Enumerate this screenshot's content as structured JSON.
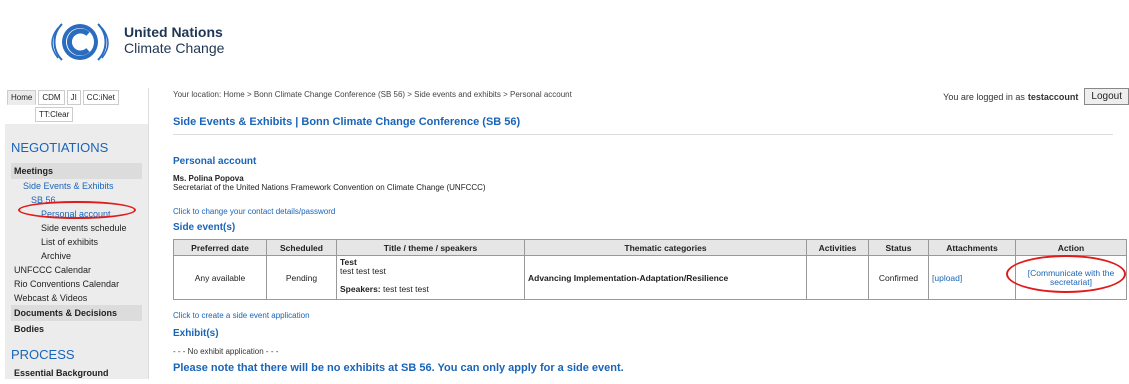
{
  "header": {
    "org_line1": "United Nations",
    "org_line2": "Climate Change",
    "brand_color": "#1a64b8"
  },
  "sidebar": {
    "tabs": [
      "Home",
      "CDM",
      "JI",
      "CC:iNet",
      "TT:Clear"
    ],
    "heading_negotiations": "NEGOTIATIONS",
    "meetings": "Meetings",
    "side_events_exhibits": "Side Events & Exhibits",
    "sb56": "SB 56",
    "personal_account": "Personal account",
    "side_events_schedule": "Side events schedule",
    "list_of_exhibits": "List of exhibits",
    "archive": "Archive",
    "unfccc_calendar": "UNFCCC Calendar",
    "rio_calendar": "Rio Conventions Calendar",
    "webcast": "Webcast & Videos",
    "documents": "Documents & Decisions",
    "bodies": "Bodies",
    "heading_process": "PROCESS",
    "essential_background": "Essential Background"
  },
  "main": {
    "breadcrumb": "Your location: Home > Bonn Climate Change Conference (SB 56) > Side events and exhibits > Personal account",
    "logged_in_prefix": "You are logged in as",
    "username": "testaccount",
    "logout": "Logout",
    "page_title": "Side Events & Exhibits | Bonn Climate Change Conference (SB 56)",
    "personal_heading": "Personal account",
    "person_name": "Ms. Polina Popova",
    "person_org": "Secretariat of the United Nations Framework Convention on Climate Change (UNFCCC)",
    "change_link": "Click to change your contact details/password",
    "side_events_heading": "Side event(s)",
    "table": {
      "headers": [
        "Preferred date",
        "Scheduled",
        "Title / theme / speakers",
        "Thematic categories",
        "Activities",
        "Status",
        "Attachments",
        "Action"
      ],
      "row": {
        "preferred_date": "Any available",
        "scheduled": "Pending",
        "title": "Test",
        "theme": "test test test",
        "speakers_label": "Speakers:",
        "speakers": "test test test",
        "category": "Advancing Implementation-Adaptation/Resilience",
        "activities": "",
        "status": "Confirmed",
        "attachment": "[upload]",
        "action": "[Communicate with the secretariat]"
      }
    },
    "create_link": "Click to create a side event application",
    "exhibits_heading": "Exhibit(s)",
    "no_exhibit": "- - - No exhibit application - - -",
    "note": "Please note that there will be no exhibits at SB 56. You can only apply for a side event."
  },
  "annotation_color": "#e01b1b"
}
